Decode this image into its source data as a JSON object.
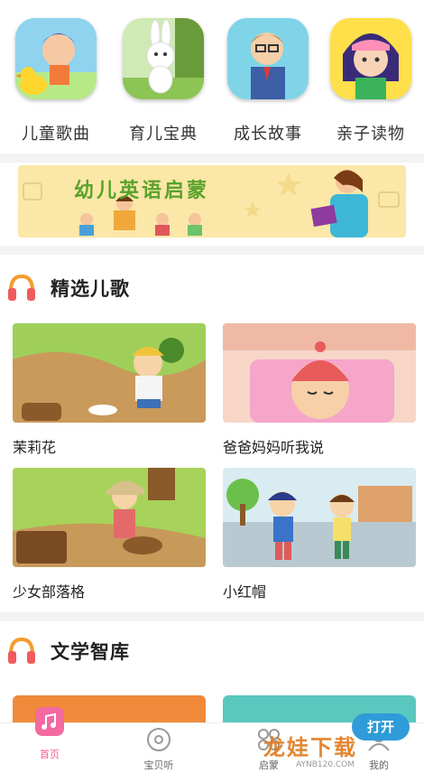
{
  "categories": [
    {
      "label": "儿童歌曲",
      "icon": "duck-kid-icon"
    },
    {
      "label": "育儿宝典",
      "icon": "rabbit-icon"
    },
    {
      "label": "成长故事",
      "icon": "teacher-icon"
    },
    {
      "label": "亲子读物",
      "icon": "girl-reader-icon"
    }
  ],
  "banner": {
    "title": "幼儿英语启蒙"
  },
  "sections": {
    "songs": {
      "title": "精选儿歌"
    },
    "library": {
      "title": "文学智库"
    }
  },
  "songs": [
    {
      "title": "茉莉花"
    },
    {
      "title": "爸爸妈妈听我说"
    },
    {
      "title": "少女部落格"
    },
    {
      "title": "小红帽"
    }
  ],
  "tabs": [
    {
      "label": "首页",
      "icon": "home-icon",
      "active": true
    },
    {
      "label": "宝贝听",
      "icon": "disc-icon",
      "active": false
    },
    {
      "label": "启蒙",
      "icon": "grid-icon",
      "active": false
    },
    {
      "label": "我的",
      "icon": "user-icon",
      "active": false
    }
  ],
  "open_button": "打开",
  "watermark": {
    "text": "龙娃下载",
    "small": "AYNB120.COM"
  },
  "colors": {
    "accent": "#f05c8e",
    "banner_bg": "#fbe7a7",
    "open_button": "#2f9bd8"
  }
}
